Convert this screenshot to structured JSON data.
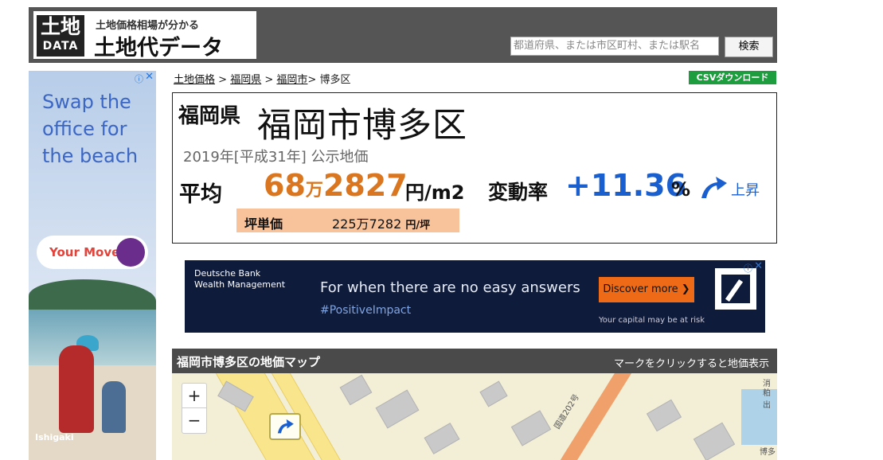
{
  "header": {
    "logo_kanji": "土地",
    "logo_data": "DATA",
    "logo_subtitle": "土地価格相場が分かる",
    "logo_title": "土地代データ",
    "search_placeholder": "都道府県、または市区町村、または駅名",
    "search_button": "検索",
    "bg_color": "#555555"
  },
  "side_ad": {
    "text_lines": [
      "Swap the",
      "office for",
      "the beach"
    ],
    "cta": "Your Move",
    "brand": "Ishigaki",
    "info": "ⓘ",
    "close": "✕",
    "text_color": "#3b66c4"
  },
  "breadcrumb": {
    "items": [
      "土地価格",
      "福岡県",
      "福岡市"
    ],
    "separator": ">",
    "current": "博多区"
  },
  "csv_button": "CSVダウンロード",
  "price": {
    "prefecture": "福岡県",
    "city": "福岡市博多区",
    "year_line": "2019年[平成31年] 公示地価",
    "avg_label": "平均",
    "avg_man": "68",
    "man_unit": "万",
    "avg_rest": "2827",
    "unit": "円/m2",
    "change_label": "変動率",
    "change_value": "+11.36",
    "percent": "%",
    "trend_icon": "up-right-arrow",
    "trend_label": "上昇",
    "tsubo_label": "坪単価",
    "tsubo_value": "225万7282",
    "tsubo_unit": "円/坪",
    "price_color": "#d9761f",
    "change_color": "#1a5fd0",
    "tsubo_bg": "#f8c39b"
  },
  "banner_ad": {
    "brand_line1": "Deutsche Bank",
    "brand_line2": "Wealth Management",
    "headline": "For when there are no easy answers",
    "hashtag": "#PositiveImpact",
    "cta": "Discover more ❯",
    "caption": "Your capital may be at risk",
    "info": "ⓘ",
    "close": "✕",
    "bg_color": "#0f1b3a",
    "cta_color": "#ee6a17"
  },
  "map": {
    "title": "福岡市博多区の地価マップ",
    "hint": "マークをクリックすると地価表示",
    "zoom_in": "+",
    "zoom_out": "−",
    "road_label": "国道202号",
    "edge_labels": [
      "消",
      "粕出",
      "博多"
    ]
  }
}
